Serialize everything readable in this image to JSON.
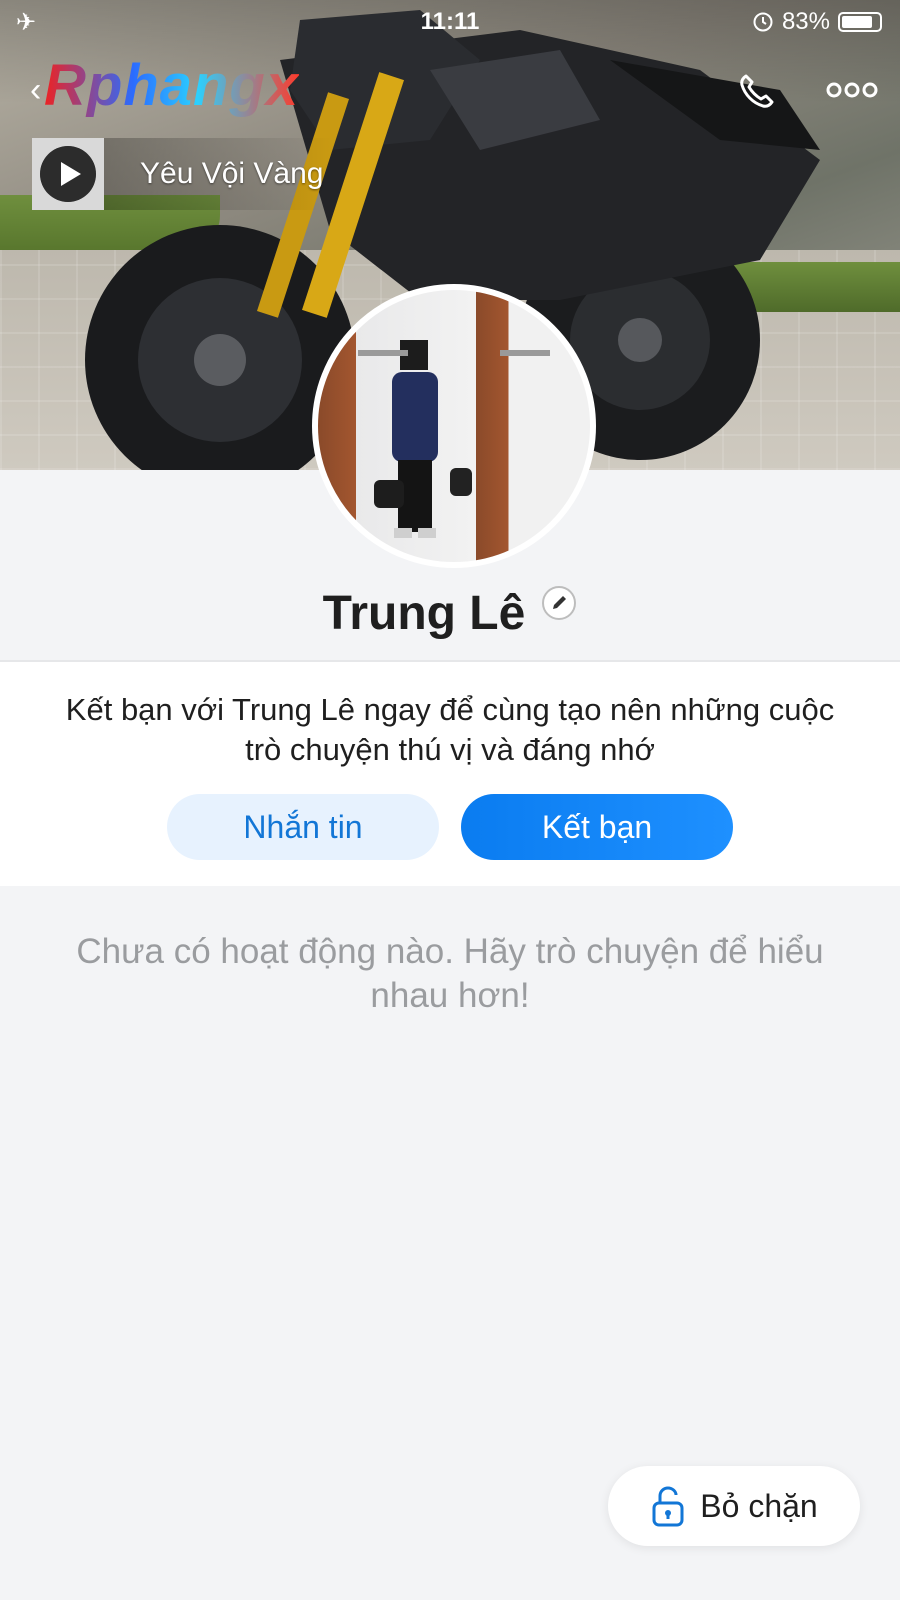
{
  "status_bar": {
    "time": "11:11",
    "battery": "83%",
    "battery_level": 0.83
  },
  "header": {
    "logo_text": "Rphangx"
  },
  "music": {
    "title": "Yêu Vội Vàng"
  },
  "profile": {
    "name": "Trung Lê"
  },
  "friend_card": {
    "invite_text": "Kết bạn với Trung Lê ngay để cùng tạo nên những cuộc trò chuyện thú vị và đáng nhớ",
    "message_button": "Nhắn tin",
    "add_friend_button": "Kết bạn"
  },
  "activity": {
    "empty_text": "Chưa có hoạt động nào. Hãy trò chuyện để hiểu nhau hơn!"
  },
  "unblock": {
    "label": "Bỏ chặn"
  },
  "colors": {
    "primary": "#0a7cf0",
    "light_primary": "#e7f2fe",
    "muted_text": "#9a9c9f"
  },
  "icons": [
    "airplane-icon",
    "alarm-icon",
    "battery-icon",
    "back-icon",
    "phone-icon",
    "more-icon",
    "play-icon",
    "edit-icon",
    "unlock-icon"
  ]
}
